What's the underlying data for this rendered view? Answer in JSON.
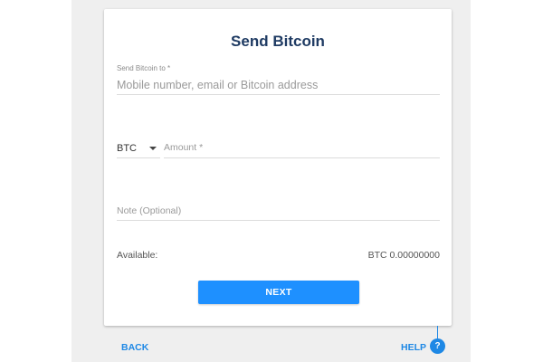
{
  "form": {
    "title": "Send Bitcoin",
    "recipient": {
      "label": "Send Bitcoin to *",
      "placeholder": "Mobile number, email or Bitcoin address"
    },
    "amount": {
      "currency": "BTC",
      "label": "Amount *"
    },
    "note": {
      "label": "Note (Optional)"
    },
    "available": {
      "label": "Available:",
      "value": "BTC 0.00000000"
    },
    "next_label": "NEXT"
  },
  "footer": {
    "back_label": "BACK",
    "help_label": "HELP",
    "help_icon_glyph": "?"
  },
  "colors": {
    "title": "#1f3b63",
    "primary_button": "#1e90ff",
    "link": "#1e88e5",
    "backdrop": "#efefef"
  }
}
